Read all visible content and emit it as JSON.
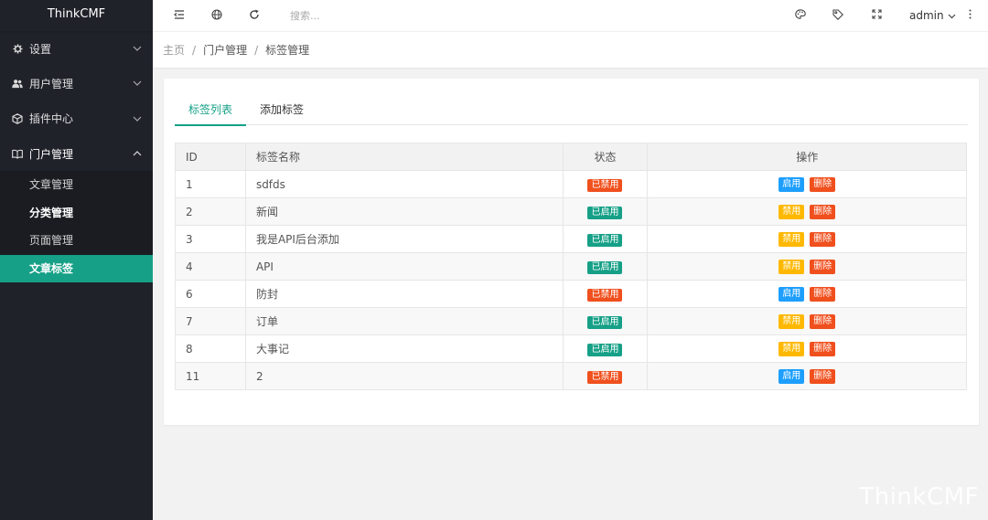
{
  "app": {
    "title": "ThinkCMF"
  },
  "sidebar": {
    "items": [
      {
        "label": "设置",
        "icon": "gear-icon",
        "open": false
      },
      {
        "label": "用户管理",
        "icon": "users-icon",
        "open": false
      },
      {
        "label": "插件中心",
        "icon": "cube-icon",
        "open": false
      },
      {
        "label": "门户管理",
        "icon": "book-icon",
        "open": true
      }
    ],
    "subitems": [
      {
        "label": "文章管理"
      },
      {
        "label": "分类管理"
      },
      {
        "label": "页面管理"
      },
      {
        "label": "文章标签"
      }
    ]
  },
  "header": {
    "search_placeholder": "搜索...",
    "user": "admin"
  },
  "breadcrumb": {
    "items": [
      "主页",
      "门户管理",
      "标签管理"
    ],
    "separator": "/"
  },
  "tabs": [
    {
      "label": "标签列表",
      "active": true
    },
    {
      "label": "添加标签",
      "active": false
    }
  ],
  "table": {
    "headers": [
      "ID",
      "标签名称",
      "状态",
      "操作"
    ],
    "rows": [
      {
        "id": "1",
        "name": "sdfds",
        "status": "已禁用",
        "toggle": "启用",
        "delete": "删除"
      },
      {
        "id": "2",
        "name": "新闻",
        "status": "已启用",
        "toggle": "禁用",
        "delete": "删除"
      },
      {
        "id": "3",
        "name": "我是API后台添加",
        "status": "已启用",
        "toggle": "禁用",
        "delete": "删除"
      },
      {
        "id": "4",
        "name": "API",
        "status": "已启用",
        "toggle": "禁用",
        "delete": "删除"
      },
      {
        "id": "6",
        "name": "防封",
        "status": "已禁用",
        "toggle": "启用",
        "delete": "删除"
      },
      {
        "id": "7",
        "name": "订单",
        "status": "已启用",
        "toggle": "禁用",
        "delete": "删除"
      },
      {
        "id": "8",
        "name": "大事记",
        "status": "已启用",
        "toggle": "禁用",
        "delete": "删除"
      },
      {
        "id": "11",
        "name": "2",
        "status": "已禁用",
        "toggle": "启用",
        "delete": "删除"
      }
    ]
  },
  "colors": {
    "accent": "#16a087",
    "disabled_badge": "#f0501e",
    "enabled_badge": "#16a087",
    "enable_button": "#1e9fff",
    "disable_button": "#ffb800",
    "delete_button": "#f0501e",
    "sidebar_bg": "#20222a"
  },
  "watermark": "ThinkCMF"
}
